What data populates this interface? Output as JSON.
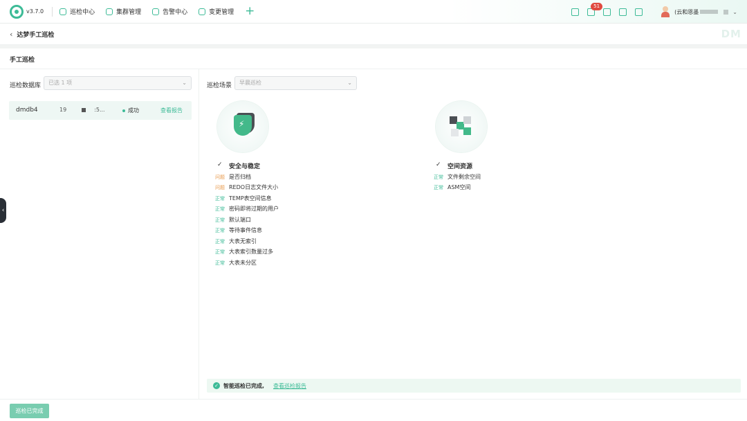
{
  "topbar": {
    "version": "v3.7.0",
    "nav": [
      {
        "label": "巡检中心",
        "icon": "hexagon-icon"
      },
      {
        "label": "集群管理",
        "icon": "cluster-icon"
      },
      {
        "label": "告警中心",
        "icon": "alert-icon"
      },
      {
        "label": "变更管理",
        "icon": "change-icon"
      }
    ],
    "notification_count": "51",
    "user_name": "(云和恩墨",
    "accent": "#3dbb97"
  },
  "breadcrumb": {
    "title": "达梦手工巡检",
    "watermark": "DM"
  },
  "section": {
    "title": "手工巡检"
  },
  "left": {
    "db_label": "巡检数据库",
    "db_select_placeholder": "已选 1 项",
    "db_row": {
      "name": "dmdb4",
      "ip_prefix": "19",
      "ip_suffix": ":5...",
      "status": "成功",
      "link": "查看报告"
    }
  },
  "right": {
    "scene_label": "巡检场景",
    "scene_select_placeholder": "早晨巡检",
    "groups": [
      {
        "title": "安全与稳定",
        "items": [
          {
            "tag": "问题",
            "label": "是否归档"
          },
          {
            "tag": "问题",
            "label": "REDO日志文件大小"
          },
          {
            "tag": "正常",
            "label": "TEMP表空间信息"
          },
          {
            "tag": "正常",
            "label": "密码即将过期的用户"
          },
          {
            "tag": "正常",
            "label": "默认端口"
          },
          {
            "tag": "正常",
            "label": "等待事件信息"
          },
          {
            "tag": "正常",
            "label": "大表无索引"
          },
          {
            "tag": "正常",
            "label": "大表索引数量过多"
          },
          {
            "tag": "正常",
            "label": "大表未分区"
          }
        ]
      },
      {
        "title": "空间资源",
        "items": [
          {
            "tag": "正常",
            "label": "文件剩余空间"
          },
          {
            "tag": "正常",
            "label": "ASM空间"
          }
        ]
      }
    ],
    "done_text": "智能巡检已完成,",
    "done_link": "查看巡检报告"
  },
  "footer": {
    "finish_button": "巡检已完成"
  }
}
